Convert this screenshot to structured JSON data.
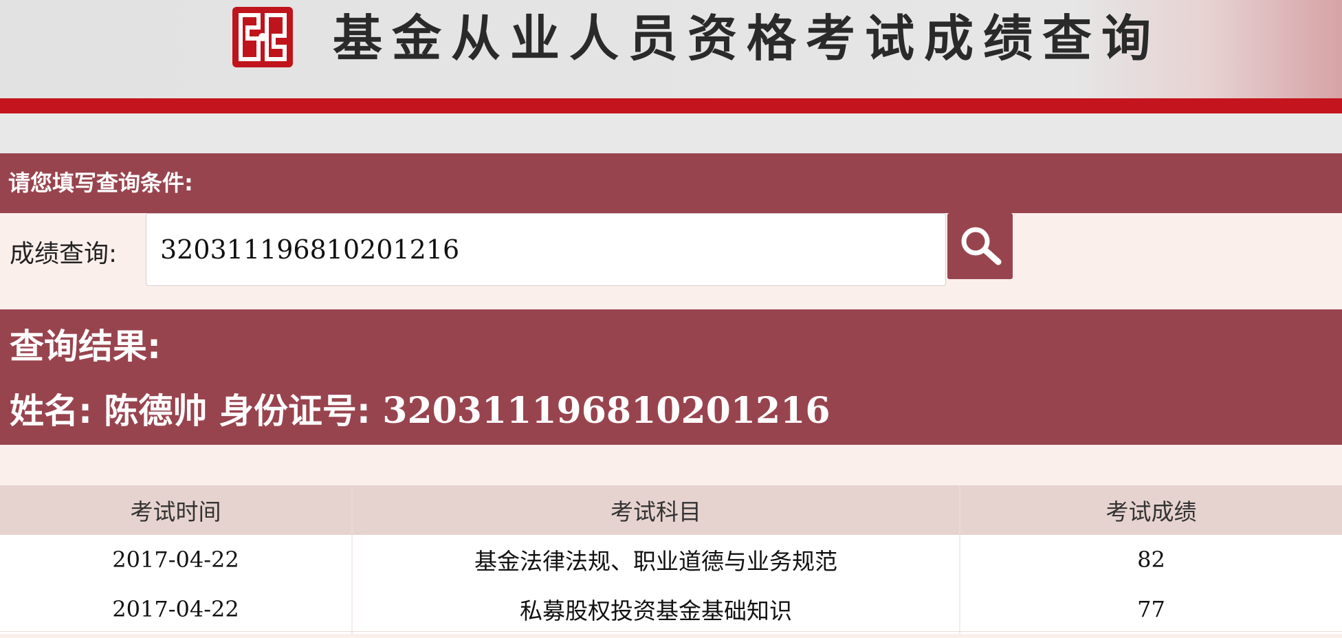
{
  "header": {
    "site_title": "基金从业人员资格考试成绩查询",
    "logo_icon": "seal-logo-icon",
    "brand_red": "#c4141e",
    "accent": "#98444e"
  },
  "query": {
    "section_label": "请您填写查询条件:",
    "field_label": "成绩查询:",
    "input_value": "320311196810201216",
    "search_icon": "magnifier-icon"
  },
  "result": {
    "title": "查询结果:",
    "name_label": "姓名:",
    "name_value": "陈德帅",
    "id_label": "身份证号:",
    "id_value": "320311196810201216"
  },
  "table": {
    "headers": [
      "考试时间",
      "考试科目",
      "考试成绩"
    ],
    "rows": [
      {
        "date": "2017-04-22",
        "subject": "基金法律法规、职业道德与业务规范",
        "score": "82"
      },
      {
        "date": "2017-04-22",
        "subject": "私募股权投资基金基础知识",
        "score": "77"
      }
    ]
  }
}
